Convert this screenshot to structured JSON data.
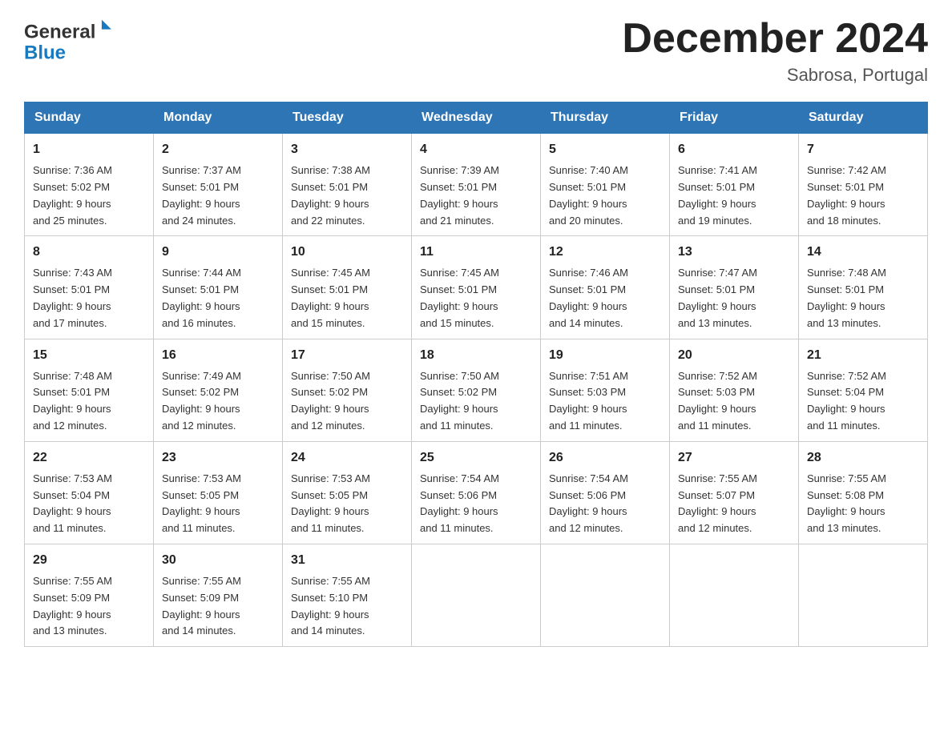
{
  "header": {
    "month_title": "December 2024",
    "location": "Sabrosa, Portugal"
  },
  "days_of_week": [
    "Sunday",
    "Monday",
    "Tuesday",
    "Wednesday",
    "Thursday",
    "Friday",
    "Saturday"
  ],
  "weeks": [
    [
      {
        "day": "1",
        "sunrise": "Sunrise: 7:36 AM",
        "sunset": "Sunset: 5:02 PM",
        "daylight": "Daylight: 9 hours",
        "daylight2": "and 25 minutes."
      },
      {
        "day": "2",
        "sunrise": "Sunrise: 7:37 AM",
        "sunset": "Sunset: 5:01 PM",
        "daylight": "Daylight: 9 hours",
        "daylight2": "and 24 minutes."
      },
      {
        "day": "3",
        "sunrise": "Sunrise: 7:38 AM",
        "sunset": "Sunset: 5:01 PM",
        "daylight": "Daylight: 9 hours",
        "daylight2": "and 22 minutes."
      },
      {
        "day": "4",
        "sunrise": "Sunrise: 7:39 AM",
        "sunset": "Sunset: 5:01 PM",
        "daylight": "Daylight: 9 hours",
        "daylight2": "and 21 minutes."
      },
      {
        "day": "5",
        "sunrise": "Sunrise: 7:40 AM",
        "sunset": "Sunset: 5:01 PM",
        "daylight": "Daylight: 9 hours",
        "daylight2": "and 20 minutes."
      },
      {
        "day": "6",
        "sunrise": "Sunrise: 7:41 AM",
        "sunset": "Sunset: 5:01 PM",
        "daylight": "Daylight: 9 hours",
        "daylight2": "and 19 minutes."
      },
      {
        "day": "7",
        "sunrise": "Sunrise: 7:42 AM",
        "sunset": "Sunset: 5:01 PM",
        "daylight": "Daylight: 9 hours",
        "daylight2": "and 18 minutes."
      }
    ],
    [
      {
        "day": "8",
        "sunrise": "Sunrise: 7:43 AM",
        "sunset": "Sunset: 5:01 PM",
        "daylight": "Daylight: 9 hours",
        "daylight2": "and 17 minutes."
      },
      {
        "day": "9",
        "sunrise": "Sunrise: 7:44 AM",
        "sunset": "Sunset: 5:01 PM",
        "daylight": "Daylight: 9 hours",
        "daylight2": "and 16 minutes."
      },
      {
        "day": "10",
        "sunrise": "Sunrise: 7:45 AM",
        "sunset": "Sunset: 5:01 PM",
        "daylight": "Daylight: 9 hours",
        "daylight2": "and 15 minutes."
      },
      {
        "day": "11",
        "sunrise": "Sunrise: 7:45 AM",
        "sunset": "Sunset: 5:01 PM",
        "daylight": "Daylight: 9 hours",
        "daylight2": "and 15 minutes."
      },
      {
        "day": "12",
        "sunrise": "Sunrise: 7:46 AM",
        "sunset": "Sunset: 5:01 PM",
        "daylight": "Daylight: 9 hours",
        "daylight2": "and 14 minutes."
      },
      {
        "day": "13",
        "sunrise": "Sunrise: 7:47 AM",
        "sunset": "Sunset: 5:01 PM",
        "daylight": "Daylight: 9 hours",
        "daylight2": "and 13 minutes."
      },
      {
        "day": "14",
        "sunrise": "Sunrise: 7:48 AM",
        "sunset": "Sunset: 5:01 PM",
        "daylight": "Daylight: 9 hours",
        "daylight2": "and 13 minutes."
      }
    ],
    [
      {
        "day": "15",
        "sunrise": "Sunrise: 7:48 AM",
        "sunset": "Sunset: 5:01 PM",
        "daylight": "Daylight: 9 hours",
        "daylight2": "and 12 minutes."
      },
      {
        "day": "16",
        "sunrise": "Sunrise: 7:49 AM",
        "sunset": "Sunset: 5:02 PM",
        "daylight": "Daylight: 9 hours",
        "daylight2": "and 12 minutes."
      },
      {
        "day": "17",
        "sunrise": "Sunrise: 7:50 AM",
        "sunset": "Sunset: 5:02 PM",
        "daylight": "Daylight: 9 hours",
        "daylight2": "and 12 minutes."
      },
      {
        "day": "18",
        "sunrise": "Sunrise: 7:50 AM",
        "sunset": "Sunset: 5:02 PM",
        "daylight": "Daylight: 9 hours",
        "daylight2": "and 11 minutes."
      },
      {
        "day": "19",
        "sunrise": "Sunrise: 7:51 AM",
        "sunset": "Sunset: 5:03 PM",
        "daylight": "Daylight: 9 hours",
        "daylight2": "and 11 minutes."
      },
      {
        "day": "20",
        "sunrise": "Sunrise: 7:52 AM",
        "sunset": "Sunset: 5:03 PM",
        "daylight": "Daylight: 9 hours",
        "daylight2": "and 11 minutes."
      },
      {
        "day": "21",
        "sunrise": "Sunrise: 7:52 AM",
        "sunset": "Sunset: 5:04 PM",
        "daylight": "Daylight: 9 hours",
        "daylight2": "and 11 minutes."
      }
    ],
    [
      {
        "day": "22",
        "sunrise": "Sunrise: 7:53 AM",
        "sunset": "Sunset: 5:04 PM",
        "daylight": "Daylight: 9 hours",
        "daylight2": "and 11 minutes."
      },
      {
        "day": "23",
        "sunrise": "Sunrise: 7:53 AM",
        "sunset": "Sunset: 5:05 PM",
        "daylight": "Daylight: 9 hours",
        "daylight2": "and 11 minutes."
      },
      {
        "day": "24",
        "sunrise": "Sunrise: 7:53 AM",
        "sunset": "Sunset: 5:05 PM",
        "daylight": "Daylight: 9 hours",
        "daylight2": "and 11 minutes."
      },
      {
        "day": "25",
        "sunrise": "Sunrise: 7:54 AM",
        "sunset": "Sunset: 5:06 PM",
        "daylight": "Daylight: 9 hours",
        "daylight2": "and 11 minutes."
      },
      {
        "day": "26",
        "sunrise": "Sunrise: 7:54 AM",
        "sunset": "Sunset: 5:06 PM",
        "daylight": "Daylight: 9 hours",
        "daylight2": "and 12 minutes."
      },
      {
        "day": "27",
        "sunrise": "Sunrise: 7:55 AM",
        "sunset": "Sunset: 5:07 PM",
        "daylight": "Daylight: 9 hours",
        "daylight2": "and 12 minutes."
      },
      {
        "day": "28",
        "sunrise": "Sunrise: 7:55 AM",
        "sunset": "Sunset: 5:08 PM",
        "daylight": "Daylight: 9 hours",
        "daylight2": "and 13 minutes."
      }
    ],
    [
      {
        "day": "29",
        "sunrise": "Sunrise: 7:55 AM",
        "sunset": "Sunset: 5:09 PM",
        "daylight": "Daylight: 9 hours",
        "daylight2": "and 13 minutes."
      },
      {
        "day": "30",
        "sunrise": "Sunrise: 7:55 AM",
        "sunset": "Sunset: 5:09 PM",
        "daylight": "Daylight: 9 hours",
        "daylight2": "and 14 minutes."
      },
      {
        "day": "31",
        "sunrise": "Sunrise: 7:55 AM",
        "sunset": "Sunset: 5:10 PM",
        "daylight": "Daylight: 9 hours",
        "daylight2": "and 14 minutes."
      },
      {
        "day": "",
        "sunrise": "",
        "sunset": "",
        "daylight": "",
        "daylight2": ""
      },
      {
        "day": "",
        "sunrise": "",
        "sunset": "",
        "daylight": "",
        "daylight2": ""
      },
      {
        "day": "",
        "sunrise": "",
        "sunset": "",
        "daylight": "",
        "daylight2": ""
      },
      {
        "day": "",
        "sunrise": "",
        "sunset": "",
        "daylight": "",
        "daylight2": ""
      }
    ]
  ]
}
